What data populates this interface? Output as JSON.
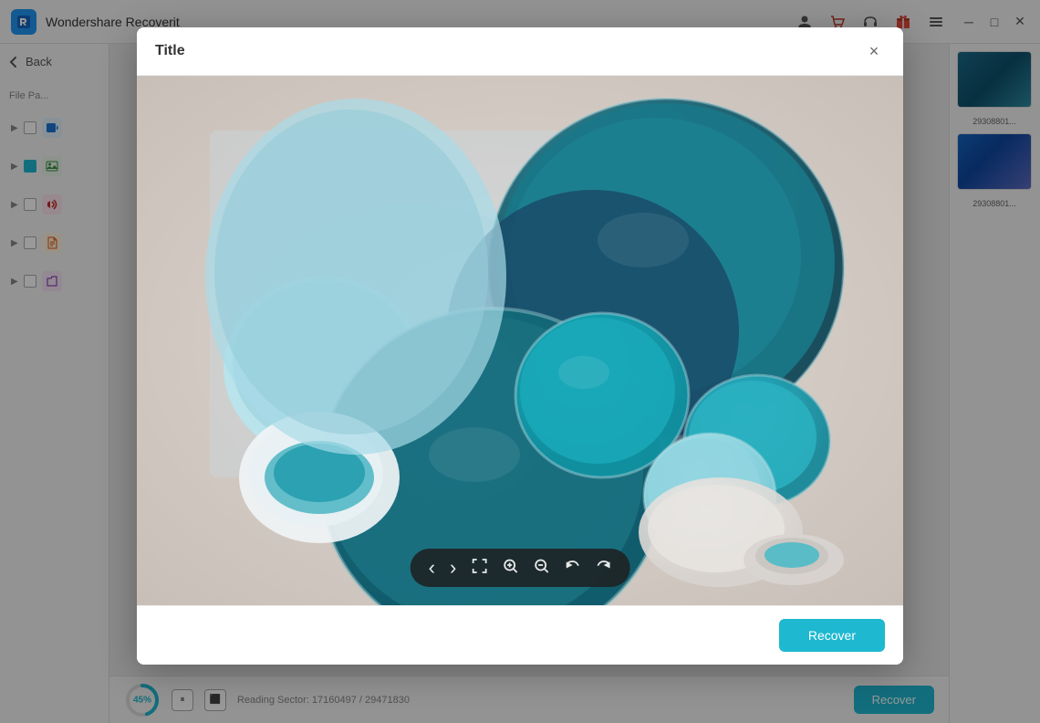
{
  "app": {
    "title": "Wondershare Recoverit",
    "logo_text": "R"
  },
  "titlebar": {
    "icons": [
      "user-icon",
      "cart-icon",
      "headset-icon",
      "gift-icon",
      "menu-icon"
    ],
    "controls": [
      "minimize-icon",
      "maximize-icon",
      "close-icon"
    ]
  },
  "sidebar": {
    "back_label": "Back",
    "section_label": "File Pa...",
    "items": [
      {
        "type": "video",
        "icon": "🎬",
        "label": ""
      },
      {
        "type": "image",
        "icon": "🖼",
        "label": ""
      },
      {
        "type": "audio",
        "icon": "🎵",
        "label": ""
      },
      {
        "type": "doc",
        "icon": "📄",
        "label": ""
      },
      {
        "type": "other",
        "icon": "📁",
        "label": ""
      }
    ]
  },
  "modal": {
    "title": "Title",
    "close_label": "×",
    "image_alt": "Paint cans in teal and cyan colors arranged on fabric"
  },
  "image_toolbar": {
    "buttons": [
      {
        "name": "prev-icon",
        "symbol": "‹",
        "label": "Previous"
      },
      {
        "name": "next-icon",
        "symbol": "›",
        "label": "Next"
      },
      {
        "name": "fullscreen-icon",
        "symbol": "⛶",
        "label": "Fullscreen"
      },
      {
        "name": "zoom-in-icon",
        "symbol": "⊕",
        "label": "Zoom In"
      },
      {
        "name": "zoom-out-icon",
        "symbol": "⊖",
        "label": "Zoom Out"
      },
      {
        "name": "rotate-left-icon",
        "symbol": "↺",
        "label": "Rotate Left"
      },
      {
        "name": "rotate-right-icon",
        "symbol": "↻",
        "label": "Rotate Right"
      }
    ]
  },
  "modal_footer": {
    "recover_label": "Recover"
  },
  "thumbnails": [
    {
      "label": "29308801...",
      "style": "t1"
    },
    {
      "label": "29308801...",
      "style": "t2"
    }
  ],
  "bottom_bar": {
    "progress_value": 45,
    "progress_label": "45%",
    "status_text": "Reading Sector: 17160497 / 29471830",
    "recover_label": "Recover"
  }
}
